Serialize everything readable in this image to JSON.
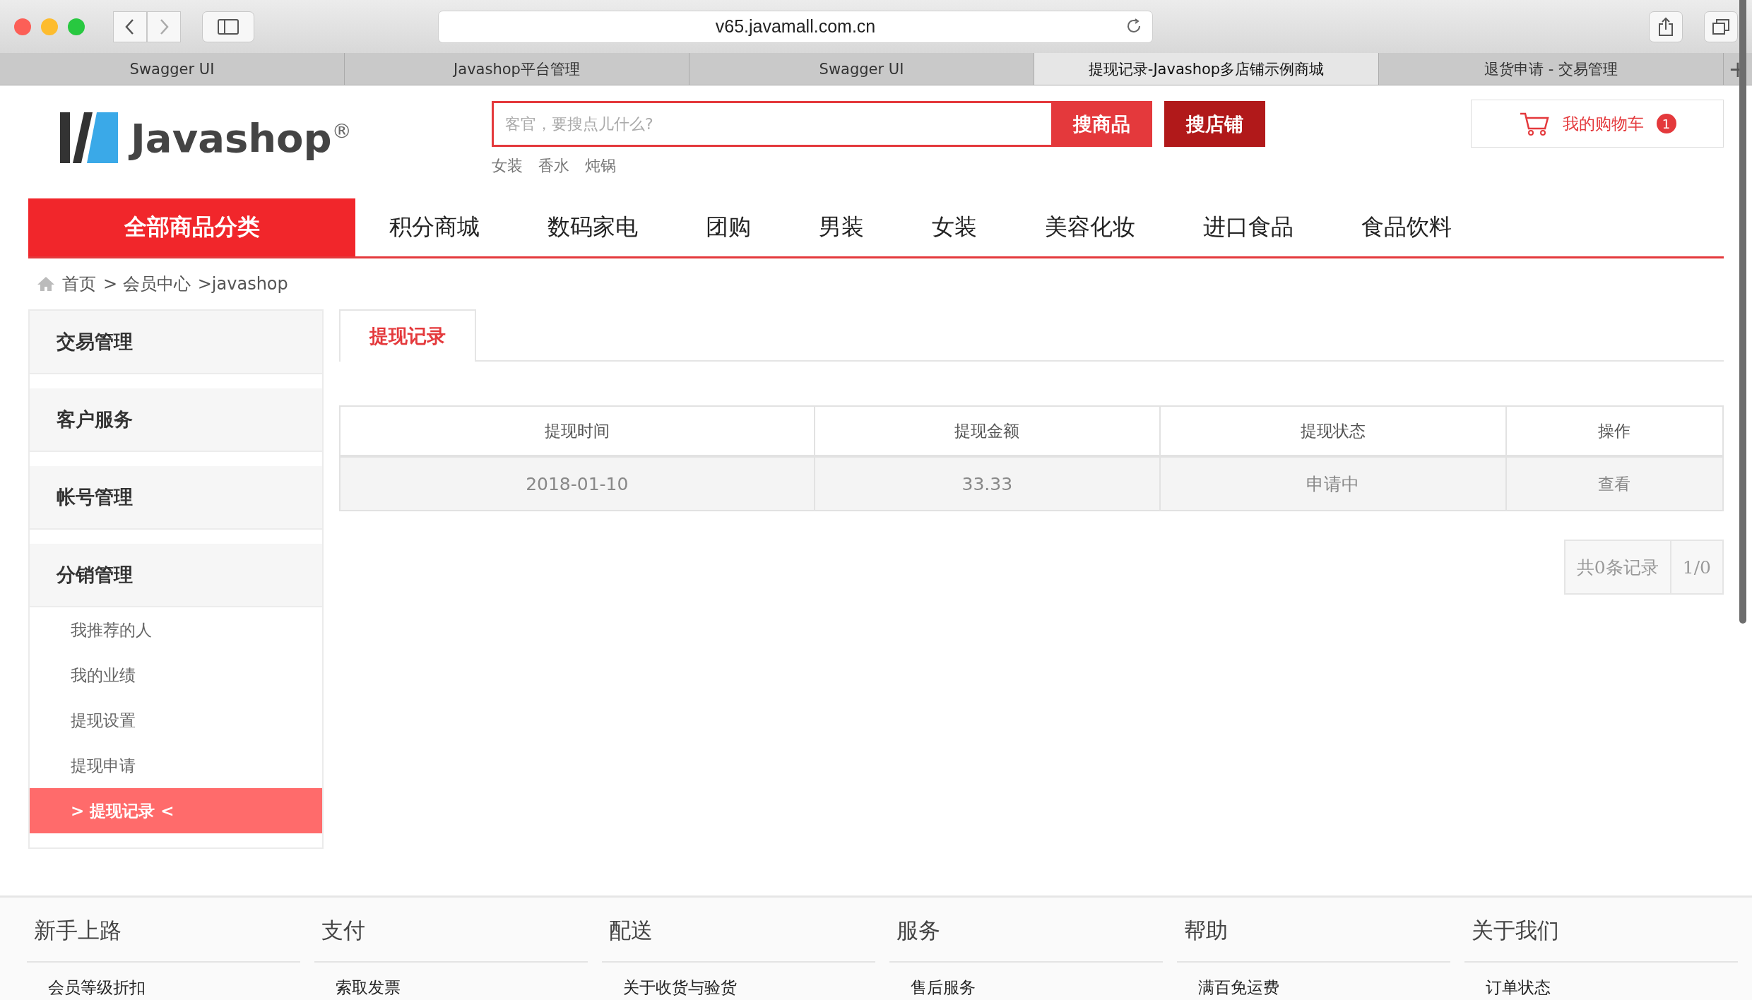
{
  "browser": {
    "url": "v65.javamall.com.cn",
    "tabs": [
      {
        "label": "Swagger UI",
        "selected": false
      },
      {
        "label": "Javashop平台管理",
        "selected": false
      },
      {
        "label": "Swagger UI",
        "selected": false
      },
      {
        "label": "提现记录-Javashop多店铺示例商城",
        "selected": true
      },
      {
        "label": "退货申请 - 交易管理",
        "selected": false
      }
    ],
    "new_tab": "+"
  },
  "header": {
    "logo_text": "Javashop",
    "logo_mark": "®",
    "search": {
      "placeholder": "客官，要搜点儿什么?"
    },
    "search_buttons": [
      "搜商品",
      "搜店铺"
    ],
    "hot_words": [
      "女装",
      "香水",
      "炖锅"
    ],
    "cart": {
      "label": "我的购物车",
      "count": "1"
    }
  },
  "nav": {
    "all_categories": "全部商品分类",
    "items": [
      "积分商城",
      "数码家电",
      "团购",
      "男装",
      "女装",
      "美容化妆",
      "进口食品",
      "食品饮料"
    ]
  },
  "breadcrumb": [
    "首页",
    "> 会员中心",
    ">javashop"
  ],
  "sidebar": {
    "sections": [
      {
        "title": "交易管理"
      },
      {
        "title": "客户服务"
      },
      {
        "title": "帐号管理"
      },
      {
        "title": "分销管理",
        "items": [
          {
            "label": "我推荐的人",
            "selected": false
          },
          {
            "label": "我的业绩",
            "selected": false
          },
          {
            "label": "提现设置",
            "selected": false
          },
          {
            "label": "提现申请",
            "selected": false
          },
          {
            "label": "> 提现记录 <",
            "selected": true
          }
        ]
      }
    ]
  },
  "content": {
    "tabs": [
      {
        "label": "提现记录",
        "selected": true
      }
    ],
    "table": {
      "columns": [
        "提现时间",
        "提现金额",
        "提现状态",
        "操作"
      ],
      "rows": [
        [
          "2018-01-10",
          "33.33",
          "申请中",
          "查看"
        ]
      ]
    },
    "pagination": {
      "total": "共0条记录",
      "page": "1/0"
    }
  },
  "footer": {
    "columns": [
      {
        "title": "新手上路",
        "items": [
          "会员等级折扣"
        ]
      },
      {
        "title": "支付",
        "items": [
          "索取发票"
        ]
      },
      {
        "title": "配送",
        "items": [
          "关于收货与验货"
        ]
      },
      {
        "title": "服务",
        "items": [
          "售后服务"
        ]
      },
      {
        "title": "帮助",
        "items": [
          "满百免运费"
        ]
      },
      {
        "title": "关于我们",
        "items": [
          "订单状态"
        ]
      }
    ]
  }
}
